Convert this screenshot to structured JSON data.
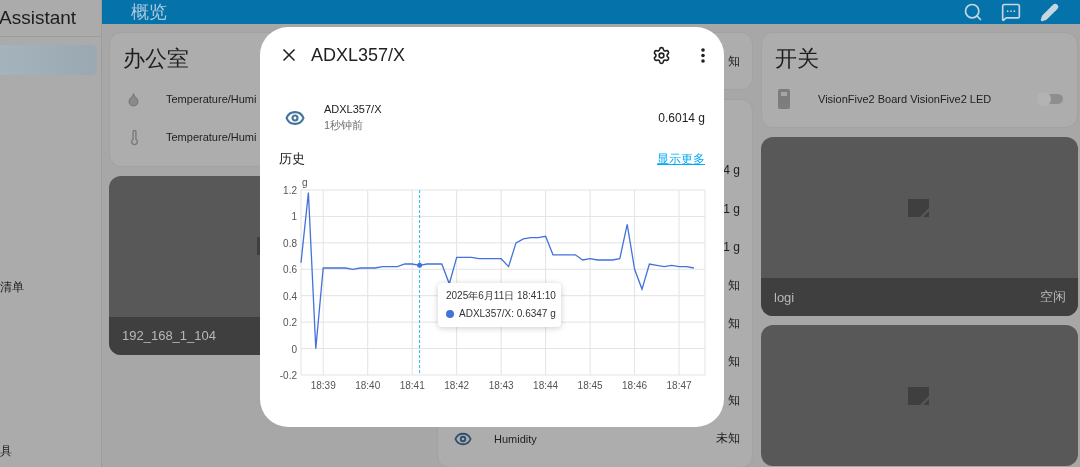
{
  "sidebar": {
    "title": "Assistant",
    "items": [
      {
        "selected": true
      },
      {
        "label": "清单",
        "selected": false
      },
      {
        "label": "具",
        "selected": false
      }
    ]
  },
  "top_bar": {
    "title": "概览"
  },
  "columns": [
    [
      {
        "kind": "entities",
        "title": "办公室",
        "rows": [
          {
            "kind": "humidity",
            "name": "Temperature/Humi"
          },
          {
            "kind": "temperature",
            "name": "Temperature/Humi"
          }
        ]
      },
      {
        "kind": "camera",
        "name": "192_168_1_104"
      }
    ],
    [
      {
        "kind": "entities",
        "rows": [
          {
            "kind": "value",
            "value": "知"
          }
        ]
      },
      {
        "kind": "entities",
        "rows": [
          {
            "kind": "value",
            "value": "4 g"
          },
          {
            "kind": "value",
            "value": "1 g"
          },
          {
            "kind": "value",
            "value": "1 g"
          },
          {
            "kind": "value",
            "value": "知"
          },
          {
            "kind": "value",
            "value": "知"
          },
          {
            "kind": "value",
            "value": "知"
          },
          {
            "kind": "value",
            "value": "知"
          },
          {
            "kind": "sensor",
            "name": "Humidity",
            "value": "未知"
          }
        ]
      }
    ],
    [
      {
        "kind": "entities",
        "title": "开关",
        "rows": [
          {
            "kind": "switch",
            "name": "VisionFive2 Board VisionFive2 LED",
            "on": false
          }
        ]
      },
      {
        "kind": "camera",
        "name": "logi",
        "state": "空闲"
      },
      {
        "kind": "camera"
      }
    ]
  ],
  "dialog": {
    "title": "ADXL357/X",
    "entity": {
      "name": "ADXL357/X",
      "time": "1秒钟前",
      "value": "0.6014 g"
    },
    "history": {
      "title": "历史",
      "link": "显示更多",
      "tooltip": {
        "title": "2025年6月11日 18:41:10",
        "value": ": 0.6347 g"
      },
      "chart_data": {
        "type": "line",
        "ylabel": "g",
        "ylim": [
          -0.2,
          1.2
        ],
        "yticks": [
          -0.2,
          0,
          0.2,
          0.4,
          0.6,
          0.8,
          1,
          1.2
        ],
        "categories": [
          null,
          null,
          null,
          "18:39",
          null,
          null,
          null,
          null,
          null,
          "18:40",
          null,
          null,
          null,
          null,
          null,
          "18:41",
          null,
          null,
          null,
          null,
          null,
          "18:42",
          null,
          null,
          null,
          null,
          null,
          "18:43",
          null,
          null,
          null,
          null,
          null,
          "18:44",
          null,
          null,
          null,
          null,
          null,
          "18:45",
          null,
          null,
          null,
          null,
          null,
          "18:46",
          null,
          null,
          null,
          null,
          null,
          "18:47",
          null,
          null
        ],
        "series": [
          {
            "name": "ADXL357/X",
            "color": "#4272db",
            "values": [
              0.65,
              1.18,
              0.0,
              0.61,
              0.61,
              0.61,
              0.61,
              0.6,
              0.61,
              0.61,
              0.61,
              0.62,
              0.62,
              0.62,
              0.64,
              0.64,
              0.63,
              0.64,
              0.64,
              0.64,
              0.49,
              0.69,
              0.69,
              0.69,
              0.68,
              0.68,
              0.68,
              0.68,
              0.62,
              0.8,
              0.83,
              0.84,
              0.84,
              0.85,
              0.71,
              0.71,
              0.71,
              0.71,
              0.67,
              0.68,
              0.67,
              0.67,
              0.67,
              0.68,
              0.94,
              0.6,
              0.45,
              0.64,
              0.63,
              0.62,
              0.63,
              0.62,
              0.62,
              0.61
            ]
          }
        ],
        "grid": true
      }
    }
  }
}
